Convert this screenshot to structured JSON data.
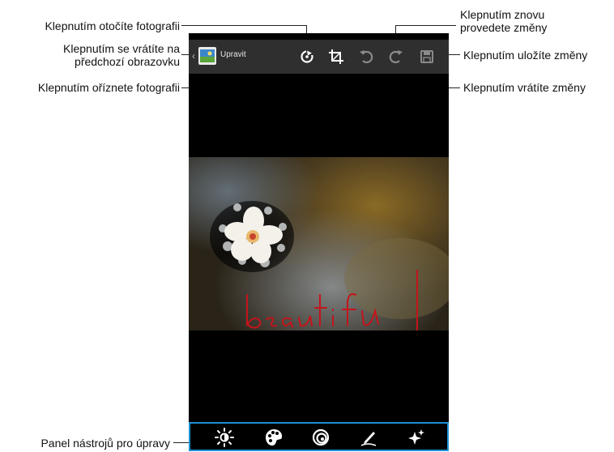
{
  "callouts": {
    "rotate": "Klepnutím otočíte fotografii",
    "back_line1": "Klepnutím se vrátíte na",
    "back_line2": "předchozí obrazovku",
    "crop": "Klepnutím oříznete fotografii",
    "redo_line1": "Klepnutím znovu",
    "redo_line2": "provedete změny",
    "save": "Klepnutím uložíte změny",
    "undo": "Klepnutím vrátíte změny",
    "toolbar": "Panel nástrojů pro úpravy"
  },
  "app": {
    "title": "Upravit"
  },
  "actionbar_icons": [
    "rotate-icon",
    "crop-icon",
    "undo-icon",
    "redo-icon",
    "save-icon"
  ],
  "toolbar_icons": [
    "brightness-icon",
    "color-palette-icon",
    "effects-icon",
    "draw-icon",
    "sparkle-icon"
  ],
  "photo": {
    "handwriting": "beautiful"
  },
  "colors": {
    "toolbar_border": "#1c8fd6",
    "actionbar_bg": "#2f2f2f",
    "handwriting": "#c4141b"
  }
}
